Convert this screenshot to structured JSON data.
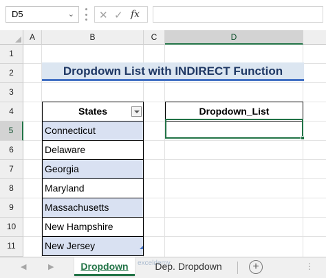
{
  "formula_bar": {
    "name_box": "D5",
    "cancel_icon": "✕",
    "enter_icon": "✓",
    "fx_label": "fx",
    "formula": ""
  },
  "columns": [
    "A",
    "B",
    "C",
    "D"
  ],
  "active_column": "D",
  "rows": [
    "1",
    "2",
    "3",
    "4",
    "5",
    "6",
    "7",
    "8",
    "9",
    "10",
    "11"
  ],
  "active_row": "5",
  "title": "Dropdown List with INDIRECT Function",
  "states_table": {
    "header": "States",
    "items": [
      "Connecticut",
      "Delaware",
      "Georgia",
      "Maryland",
      "Massachusetts",
      "New Hampshire",
      "New Jersey"
    ]
  },
  "dropdown_table": {
    "header": "Dropdown_List",
    "value": ""
  },
  "sheet_tabs": {
    "tabs": [
      "Dropdown",
      "Dep. Dropdown"
    ],
    "active": "Dropdown",
    "add_icon": "+",
    "watermark": "exceldemy"
  },
  "colors": {
    "accent_green": "#217346",
    "title_fill": "#dce6f1",
    "title_underline": "#4472c4",
    "band_fill": "#d9e1f2"
  }
}
